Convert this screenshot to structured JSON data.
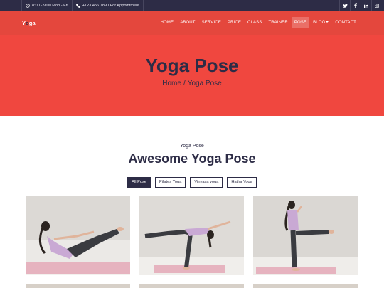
{
  "topbar": {
    "hours": "8:00 - 9:00 Mon - Fri",
    "phone": "+123 456 7890 For Appointment",
    "social": [
      "twitter-icon",
      "facebook-icon",
      "linkedin-icon",
      "instagram-icon"
    ]
  },
  "nav": {
    "logo_first": "Y",
    "logo_accent": "o",
    "logo_rest": "ga",
    "items": [
      "HOME",
      "ABOUT",
      "SERVICE",
      "PRICE",
      "CLASS",
      "TRAINER",
      "POSE",
      "BLOG",
      "CONTACT"
    ],
    "active_index": 6
  },
  "hero": {
    "title": "Yoga Pose",
    "breadcrumb_home": "Home",
    "breadcrumb_sep": "/",
    "breadcrumb_current": "Yoga Pose"
  },
  "section": {
    "tag": "Yoga Pose",
    "title": "Awesome Yoga Pose"
  },
  "filters": [
    "All Pose",
    "Pilates Yoga",
    "Vinyasa yoga",
    "Hatha Yoga"
  ],
  "colors": {
    "primary": "#e4473d",
    "dark": "#2d2c46",
    "hero_bg": "#f0473f"
  }
}
